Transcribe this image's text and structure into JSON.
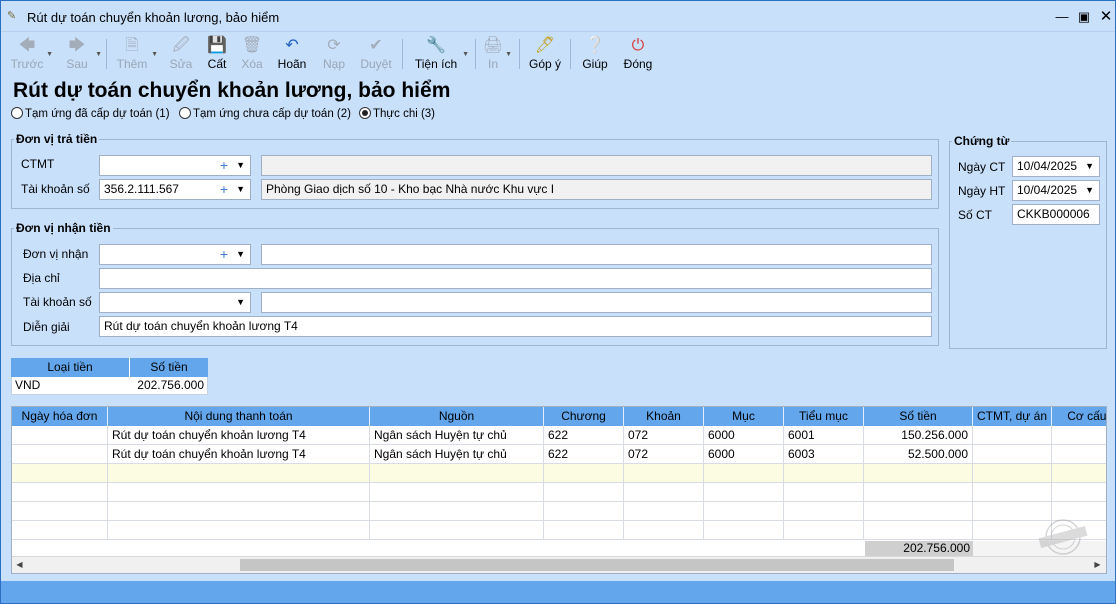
{
  "window": {
    "title": "Rút dự toán chuyển khoản lương, bảo hiểm",
    "app_icon": "document-icon",
    "controls": [
      "minimize",
      "maximize",
      "close"
    ]
  },
  "toolbar": {
    "back": "Trước",
    "next": "Sau",
    "add": "Thêm",
    "edit": "Sửa",
    "save": "Cất",
    "delete": "Xóa",
    "undo": "Hoãn",
    "load": "Nạp",
    "approve": "Duyệt",
    "utilities": "Tiện ích",
    "print": "In",
    "feedback": "Góp ý",
    "help": "Giúp",
    "close": "Đóng"
  },
  "page": {
    "heading": "Rút dự toán chuyển khoản lương, bảo hiểm"
  },
  "options": {
    "opt1": "Tạm ứng đã cấp dự toán (1)",
    "opt2": "Tạm ứng chưa cấp dự toán (2)",
    "opt3": "Thực chi (3)",
    "selected": "opt3"
  },
  "payer": {
    "legend": "Đơn vị trả tiền",
    "ctmt_label": "CTMT",
    "ctmt_value": "",
    "ctmt_desc": "",
    "account_label": "Tài khoản số",
    "account_value": "356.2.111.567",
    "account_desc": "Phòng Giao dịch số 10 - Kho bạc Nhà nước Khu vực I"
  },
  "payee": {
    "legend": "Đơn vị nhận tiền",
    "unit_label": "Đơn vị nhận",
    "unit_value": "",
    "unit_desc": "",
    "address_label": "Địa chỉ",
    "address_value": "",
    "account_label": "Tài khoản số",
    "account_value": "",
    "account_desc": "",
    "note_label": "Diễn giải",
    "note_value": "Rút dự toán chuyển khoản lương T4"
  },
  "voucher": {
    "legend": "Chứng từ",
    "date_ct_label": "Ngày CT",
    "date_ct_value": "10/04/2025",
    "date_ht_label": "Ngày HT",
    "date_ht_value": "10/04/2025",
    "no_label": "Số CT",
    "no_value": "CKKB000006"
  },
  "currency": {
    "col_type": "Loại tiền",
    "col_amount": "Số tiền",
    "type": "VND",
    "amount": "202.756.000"
  },
  "grid": {
    "columns": [
      "Ngày hóa đơn",
      "Nội dung thanh toán",
      "Nguồn",
      "Chương",
      "Khoản",
      "Mục",
      "Tiểu mục",
      "Số tiền",
      "CTMT, dự án",
      "Cơ cấu v"
    ],
    "rows": [
      [
        "",
        "Rút dự toán chuyển khoản lương T4",
        "Ngân sách Huyện tự chủ",
        "622",
        "072",
        "6000",
        "6001",
        "150.256.000",
        "",
        ""
      ],
      [
        "",
        "Rút dự toán chuyển khoản lương T4",
        "Ngân sách Huyện tự chủ",
        "622",
        "072",
        "6000",
        "6003",
        "52.500.000",
        "",
        ""
      ]
    ],
    "total": "202.756.000"
  }
}
